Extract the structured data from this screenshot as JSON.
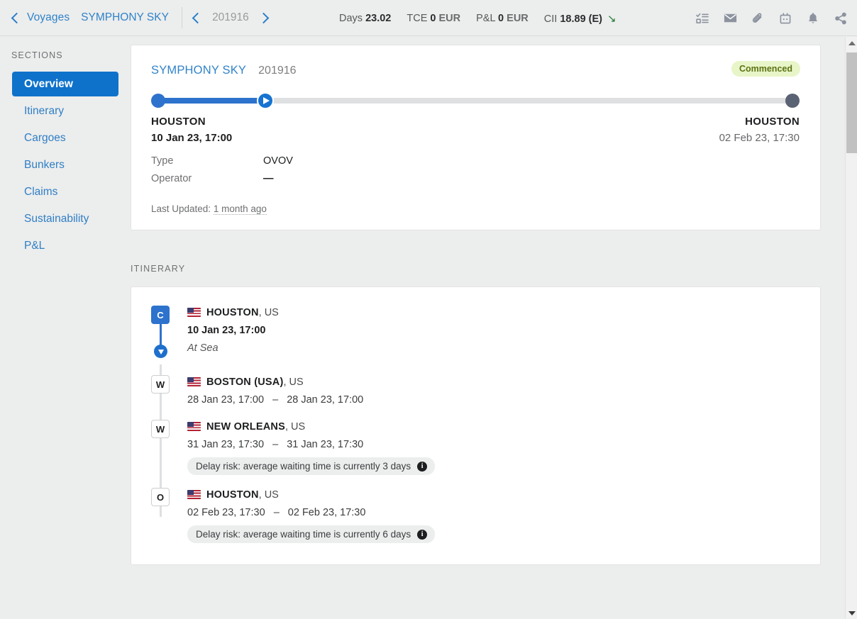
{
  "topbar": {
    "back_label": "Voyages",
    "vessel": "SYMPHONY SKY",
    "voyage_number": "201916",
    "prev_icon": "chevron-left-icon",
    "next_icon": "chevron-right-icon",
    "kpis": [
      {
        "label": "Days",
        "value": "23.02",
        "unit": ""
      },
      {
        "label": "TCE",
        "value": "0",
        "unit": "EUR"
      },
      {
        "label": "P&L",
        "value": "0",
        "unit": "EUR"
      },
      {
        "label": "CII",
        "value": "18.89 (E)",
        "unit": "",
        "trend": "↘",
        "trend_color": "#1d7a33"
      }
    ],
    "icons": [
      "tasks-icon",
      "mail-icon",
      "attachment-icon",
      "inbox-icon",
      "bell-icon",
      "share-icon"
    ]
  },
  "sidebar": {
    "heading": "SECTIONS",
    "items": [
      {
        "label": "Overview",
        "active": true
      },
      {
        "label": "Itinerary",
        "active": false
      },
      {
        "label": "Cargoes",
        "active": false
      },
      {
        "label": "Bunkers",
        "active": false
      },
      {
        "label": "Claims",
        "active": false
      },
      {
        "label": "Sustainability",
        "active": false
      },
      {
        "label": "P&L",
        "active": false
      }
    ]
  },
  "overview": {
    "vessel": "SYMPHONY SKY",
    "voyage_number": "201916",
    "status_badge": "Commenced",
    "progress_percent": 15,
    "departure": {
      "port": "HOUSTON",
      "datetime": "10 Jan 23, 17:00"
    },
    "arrival": {
      "port": "HOUSTON",
      "datetime": "02 Feb 23, 17:30"
    },
    "fields": [
      {
        "key": "Type",
        "value": "OVOV"
      },
      {
        "key": "Operator",
        "value": "—"
      }
    ],
    "last_updated_label": "Last Updated:",
    "last_updated_value": "1 month ago"
  },
  "itinerary": {
    "section_title": "ITINERARY",
    "stops": [
      {
        "badge": "C",
        "badge_style": "filled",
        "flag": "us-flag-icon",
        "port": "HOUSTON",
        "country": ", US",
        "dates": "10 Jan 23, 17:00",
        "dates_bold": true,
        "risk": null
      },
      {
        "badge": "W",
        "badge_style": "outline",
        "flag": "us-flag-icon",
        "port": "BOSTON (USA)",
        "country": ", US",
        "date_from": "28 Jan 23, 17:00",
        "date_sep": "–",
        "date_to": "28 Jan 23, 17:00",
        "dates_bold": false,
        "risk": null
      },
      {
        "badge": "W",
        "badge_style": "outline",
        "flag": "us-flag-icon",
        "port": "NEW ORLEANS",
        "country": ", US",
        "date_from": "31 Jan 23, 17:30",
        "date_sep": "–",
        "date_to": "31 Jan 23, 17:30",
        "dates_bold": false,
        "risk": "Delay risk: average waiting time is currently 3 days"
      },
      {
        "badge": "O",
        "badge_style": "outline",
        "flag": "us-flag-icon",
        "port": "HOUSTON",
        "country": ", US",
        "date_from": "02 Feb 23, 17:30",
        "date_sep": "–",
        "date_to": "02 Feb 23, 17:30",
        "dates_bold": false,
        "risk": "Delay risk: average waiting time is currently 6 days"
      }
    ],
    "at_sea_label": "At Sea",
    "info_icon_char": "i"
  },
  "colors": {
    "accent_blue": "#2d72cc",
    "link_blue": "#3083c9",
    "sidebar_active": "#0e72cb",
    "badge_bg": "#e8f5c8",
    "badge_text": "#5c7314",
    "end_dot": "#5a6374",
    "page_bg": "#eceded"
  }
}
